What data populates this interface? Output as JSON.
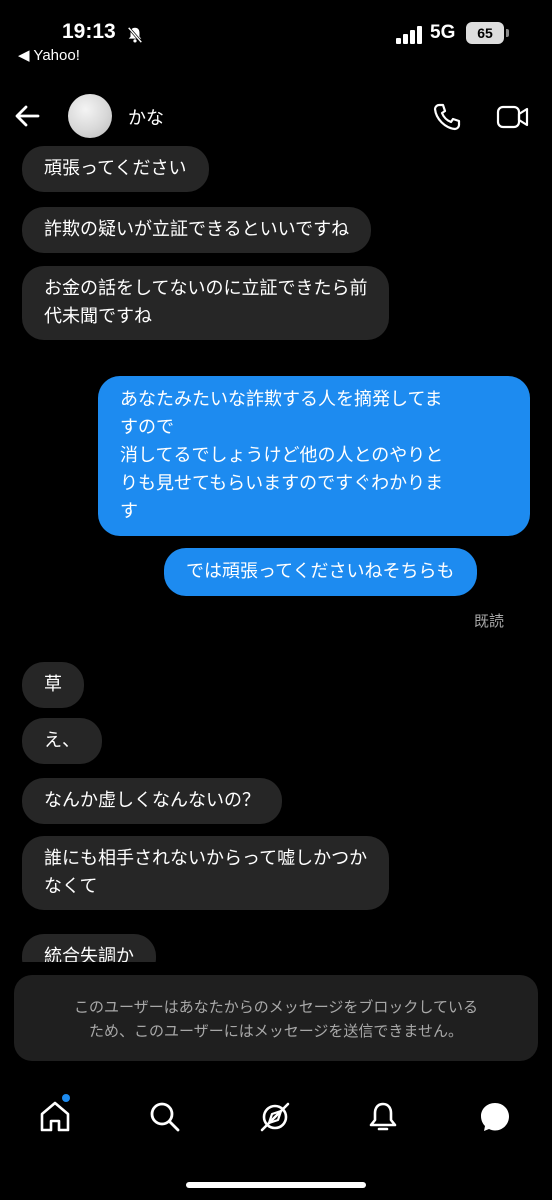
{
  "status_bar": {
    "time": "19:13",
    "back_app": "◀ Yahoo!",
    "network": "5G",
    "battery": "65"
  },
  "header": {
    "contact_name": "かな"
  },
  "messages": [
    {
      "side": "in",
      "text": "頑張ってください"
    },
    {
      "side": "in",
      "text": "詐欺の疑いが立証できるといいですね"
    },
    {
      "side": "in",
      "text": "お金の話をしてないのに立証できたら前\n代未聞ですね"
    },
    {
      "side": "out",
      "text": "あなたみたいな詐欺する人を摘発してま\nすので\n消してるでしょうけど他の人とのやりと\nりも見せてもらいますのですぐわかりま\nす"
    },
    {
      "side": "out",
      "text": "では頑張ってくださいねそちらも"
    },
    {
      "side": "in",
      "text": "草"
    },
    {
      "side": "in",
      "text": "え、"
    },
    {
      "side": "in",
      "text": "なんか虚しくなんないの？"
    },
    {
      "side": "in",
      "text": "誰にも相手されないからって嘘しかつか\nなくて"
    },
    {
      "side": "in",
      "text": "統合失調か"
    }
  ],
  "read_receipt": "既読",
  "blocked_notice": "このユーザーはあなたからのメッセージをブロックしている\nため、このユーザーにはメッセージを送信できません。",
  "nav": {
    "items": [
      "home-icon",
      "search-icon",
      "explore-icon",
      "notifications-icon",
      "messages-icon"
    ]
  },
  "colors": {
    "background": "#000000",
    "incoming_bubble": "#262626",
    "outgoing_bubble": "#1d8bf0",
    "muted_text": "#a8a8a8"
  }
}
